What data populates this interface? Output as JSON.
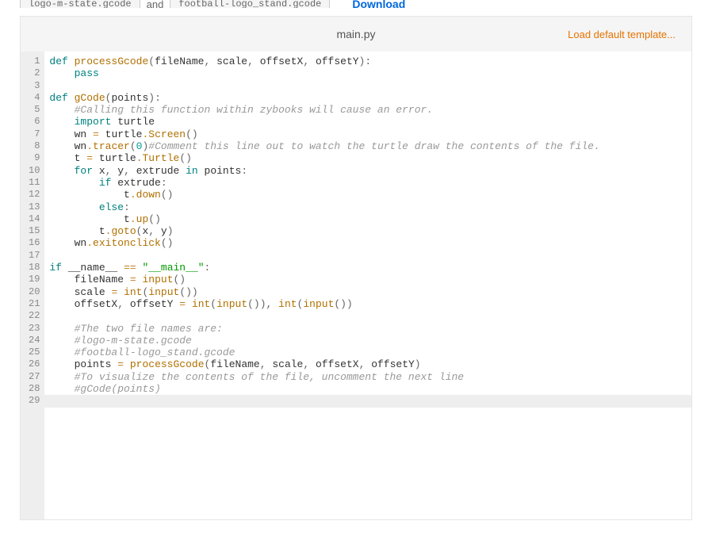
{
  "topbar": {
    "file1": "logo-m-state.gcode",
    "and": "and",
    "file2": "football-logo_stand.gcode",
    "download": "Download"
  },
  "header": {
    "filename": "main.py",
    "loadTemplate": "Load default template..."
  },
  "code": {
    "l1": {
      "kw1": "def",
      "fn": "processGcode",
      "p1": "(",
      "a1": "fileName",
      "c1": ", ",
      "a2": "scale",
      "c2": ", ",
      "a3": "offsetX",
      "c3": ", ",
      "a4": "offsetY",
      "p2": "):"
    },
    "l2": {
      "kw": "pass"
    },
    "l4": {
      "kw1": "def",
      "fn": "gCode",
      "p1": "(",
      "a1": "points",
      "p2": "):"
    },
    "l5": {
      "cm": "#Calling this function within zybooks will cause an error."
    },
    "l6": {
      "kw": "import",
      "mod": "turtle"
    },
    "l7": {
      "v": "wn",
      "op": "=",
      "m": "turtle",
      "d": ".",
      "fn": "Screen",
      "p": "()"
    },
    "l8": {
      "v": "wn",
      "d": ".",
      "fn": "tracer",
      "p1": "(",
      "n": "0",
      "p2": ")",
      "cm": "#Comment this line out to watch the turtle draw the contents of the file."
    },
    "l9": {
      "v": "t",
      "op": "=",
      "m": "turtle",
      "d": ".",
      "fn": "Turtle",
      "p": "()"
    },
    "l10": {
      "kw": "for",
      "v1": "x",
      "c1": ", ",
      "v2": "y",
      "c2": ", ",
      "v3": "extrude",
      "kw2": "in",
      "v4": "points",
      "p": ":"
    },
    "l11": {
      "kw": "if",
      "v": "extrude",
      "p": ":"
    },
    "l12": {
      "v": "t",
      "d": ".",
      "fn": "down",
      "p": "()"
    },
    "l13": {
      "kw": "else",
      "p": ":"
    },
    "l14": {
      "v": "t",
      "d": ".",
      "fn": "up",
      "p": "()"
    },
    "l15": {
      "v": "t",
      "d": ".",
      "fn": "goto",
      "p1": "(",
      "a1": "x",
      "c": ", ",
      "a2": "y",
      "p2": ")"
    },
    "l16": {
      "v": "wn",
      "d": ".",
      "fn": "exitonclick",
      "p": "()"
    },
    "l18": {
      "kw": "if",
      "v": "__name__",
      "op": "==",
      "s": "\"__main__\"",
      "p": ":"
    },
    "l19": {
      "v": "fileName",
      "op": "=",
      "fn": "input",
      "p": "()"
    },
    "l20": {
      "v": "scale",
      "op": "=",
      "fn1": "int",
      "p1": "(",
      "fn2": "input",
      "p2": "())"
    },
    "l21": {
      "v1": "offsetX",
      "c1": ", ",
      "v2": "offsetY",
      "op": "=",
      "fn1": "int",
      "p1": "(",
      "fn2": "input",
      "p2": "()), ",
      "fn3": "int",
      "p3": "(",
      "fn4": "input",
      "p4": "())"
    },
    "l23": {
      "cm": "#The two file names are:"
    },
    "l24": {
      "cm": "#logo-m-state.gcode"
    },
    "l25": {
      "cm": "#football-logo_stand.gcode"
    },
    "l26": {
      "v": "points",
      "op": "=",
      "fn": "processGcode",
      "p1": "(",
      "a1": "fileName",
      "c1": ", ",
      "a2": "scale",
      "c2": ", ",
      "a3": "offsetX",
      "c3": ", ",
      "a4": "offsetY",
      "p2": ")"
    },
    "l27": {
      "cm": "#To visualize the contents of the file, uncomment the next line"
    },
    "l28": {
      "cm": "#gCode(points)"
    }
  },
  "lines": 29
}
